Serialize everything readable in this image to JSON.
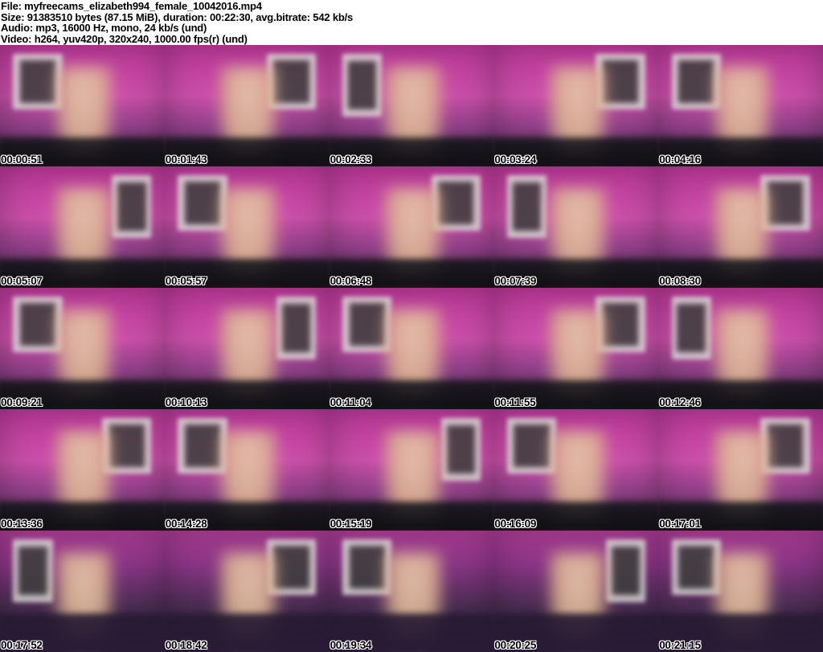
{
  "header": {
    "lines": [
      "File: myfreecams_elizabeth994_female_10042016.mp4",
      "Size: 91383510 bytes (87.15 MiB), duration: 00:22:30, avg.bitrate: 542 kb/s",
      "Audio: mp3, 16000 Hz, mono, 24 kb/s (und)",
      "Video: h264, yuv420p, 320x240, 1000.00 fps(r) (und)"
    ]
  },
  "grid": {
    "columns": 5,
    "rows": 5,
    "thumbnails": [
      {
        "timestamp": "00:00:51"
      },
      {
        "timestamp": "00:01:43"
      },
      {
        "timestamp": "00:02:33"
      },
      {
        "timestamp": "00:03:24"
      },
      {
        "timestamp": "00:04:16"
      },
      {
        "timestamp": "00:05:07"
      },
      {
        "timestamp": "00:05:57"
      },
      {
        "timestamp": "00:06:48"
      },
      {
        "timestamp": "00:07:39"
      },
      {
        "timestamp": "00:08:30"
      },
      {
        "timestamp": "00:09:21"
      },
      {
        "timestamp": "00:10:13"
      },
      {
        "timestamp": "00:11:04"
      },
      {
        "timestamp": "00:11:55"
      },
      {
        "timestamp": "00:12:46"
      },
      {
        "timestamp": "00:13:36"
      },
      {
        "timestamp": "00:14:28"
      },
      {
        "timestamp": "00:15:19"
      },
      {
        "timestamp": "00:16:09"
      },
      {
        "timestamp": "00:17:01"
      },
      {
        "timestamp": "00:17:52"
      },
      {
        "timestamp": "00:18:42"
      },
      {
        "timestamp": "00:19:34"
      },
      {
        "timestamp": "00:20:25"
      },
      {
        "timestamp": "00:21:15"
      }
    ]
  },
  "colors": {
    "header_bg": "#ffffff",
    "header_text": "#000000",
    "wall_magenta": "#c23a9e",
    "bed_purple": "#4a2d52",
    "pillow_dark": "#141418",
    "frame_gray": "#d9d9d4",
    "timestamp_text": "#000000",
    "timestamp_outline": "#ffffff"
  }
}
